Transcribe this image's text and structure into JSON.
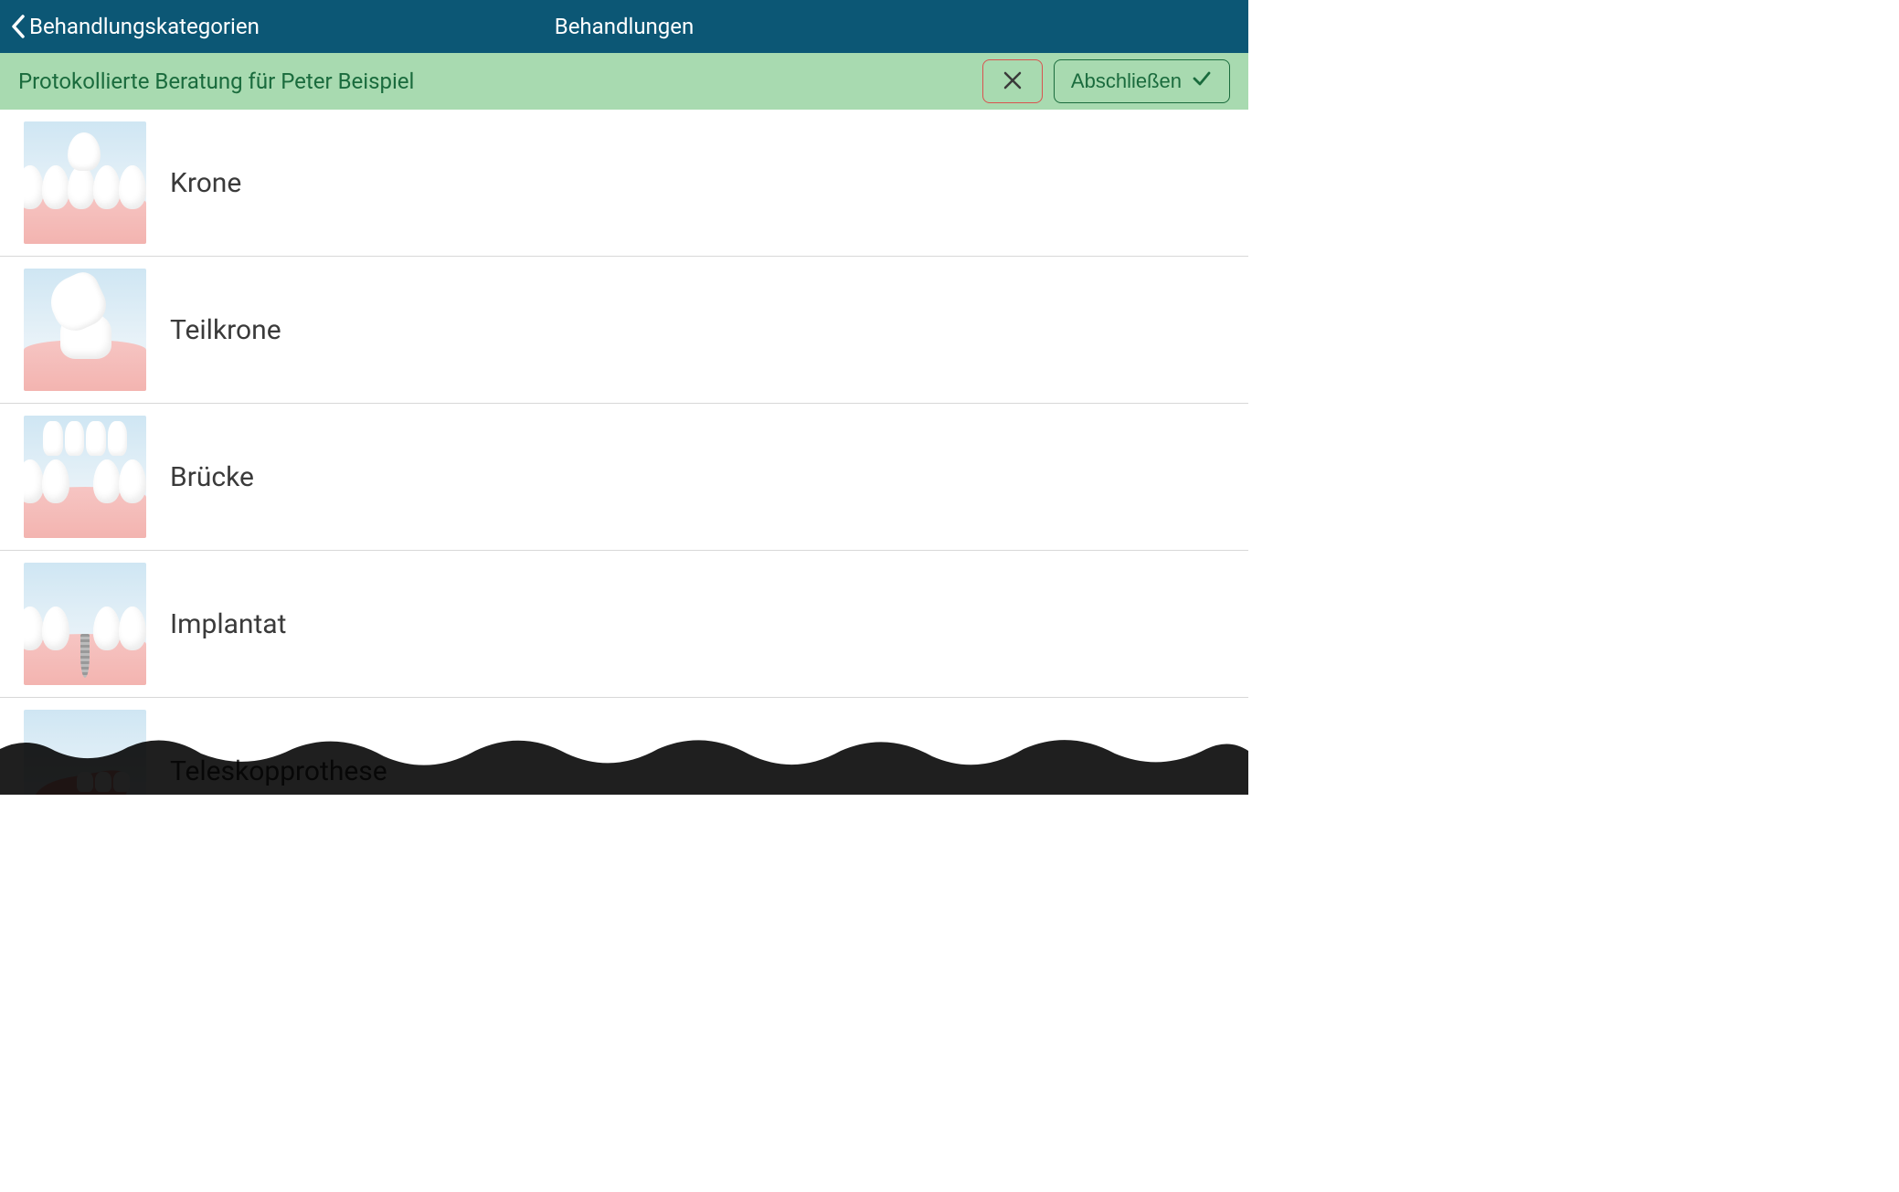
{
  "header": {
    "back_label": "Behandlungskategorien",
    "title": "Behandlungen"
  },
  "banner": {
    "text": "Protokollierte Beratung für Peter Beispiel",
    "complete_label": "Abschließen"
  },
  "treatments": [
    {
      "label": "Krone",
      "thumb": "crown"
    },
    {
      "label": "Teilkrone",
      "thumb": "partial"
    },
    {
      "label": "Brücke",
      "thumb": "bridge"
    },
    {
      "label": "Implantat",
      "thumb": "implant"
    },
    {
      "label": "Teleskopprothese",
      "thumb": "prosthesis"
    }
  ]
}
